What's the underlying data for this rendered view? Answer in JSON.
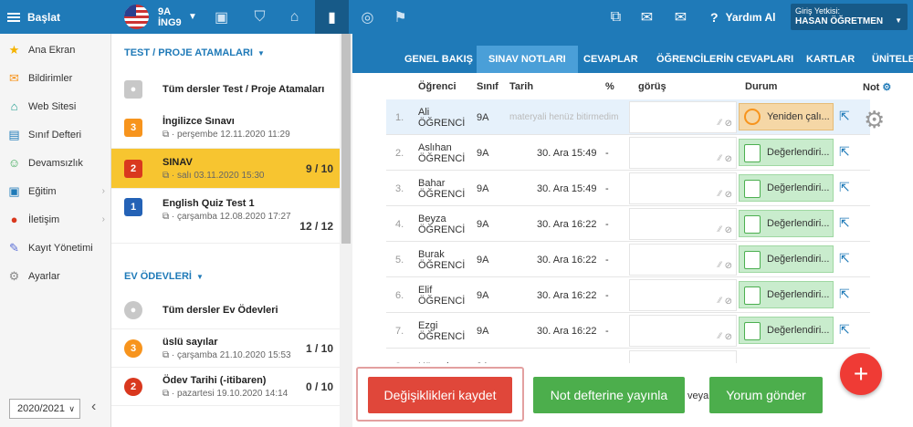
{
  "topbar": {
    "menu_label": "Başlat",
    "class_line1": "9A",
    "class_line2": "İNG9",
    "help_label": "Yardım Al",
    "login_title": "Giriş Yetkisi:",
    "login_user": "HASAN ÖĞRETMEN"
  },
  "sidebar": {
    "items": [
      {
        "label": "Ana Ekran",
        "icon": "star-icon"
      },
      {
        "label": "Bildirimler",
        "icon": "envelope-icon"
      },
      {
        "label": "Web Sitesi",
        "icon": "home-icon"
      },
      {
        "label": "Sınıf Defteri",
        "icon": "notebook-icon"
      },
      {
        "label": "Devamsızlık",
        "icon": "user-icon"
      },
      {
        "label": "Eğitim",
        "icon": "briefcase-icon"
      },
      {
        "label": "İletişim",
        "icon": "chat-icon"
      },
      {
        "label": "Kayıt Yönetimi",
        "icon": "pen-icon"
      },
      {
        "label": "Ayarlar",
        "icon": "gear-icon"
      }
    ],
    "year": "2020/2021"
  },
  "assignments": {
    "title": "TEST / PROJE ATAMALARI",
    "all_label": "Tüm dersler Test / Proje Atamaları",
    "items": [
      {
        "badge": "3",
        "title": "İngilizce Sınavı",
        "date": "perşembe 12.11.2020 11:29",
        "count": ""
      },
      {
        "badge": "2",
        "title": "SINAV",
        "date": "salı 03.11.2020 15:30",
        "count": "9 / 10"
      },
      {
        "badge": "1",
        "title": "English Quiz Test 1",
        "date": "çarşamba 12.08.2020 17:27",
        "count": "12 / 12"
      }
    ]
  },
  "homework": {
    "title": "EV ÖDEVLERİ",
    "all_label": "Tüm dersler Ev Ödevleri",
    "items": [
      {
        "badge": "3",
        "title": "üslü sayılar",
        "date": "çarşamba 21.10.2020 15:53",
        "count": "1 / 10"
      },
      {
        "badge": "2",
        "title": "Ödev Tarihi (-itibaren)",
        "date": "pazartesi 19.10.2020 14:14",
        "count": "0 / 10"
      }
    ]
  },
  "tabs": [
    "GENEL BAKIŞ",
    "SINAV NOTLARI",
    "CEVAPLAR",
    "ÖĞRENCİLERİN CEVAPLARI",
    "KARTLAR",
    "ÜNİTELER"
  ],
  "table": {
    "headers": {
      "student": "Öğrenci",
      "class": "Sınıf",
      "date": "Tarih",
      "percent": "%",
      "opinion": "görüş",
      "status": "Durum",
      "grade": "Not"
    },
    "rows": [
      {
        "n": "1.",
        "first": "Ali",
        "last": "ÖĞRENCİ",
        "cls": "9A",
        "date": "materyali henüz bitirmedim",
        "pct": "",
        "status": "Yeniden çalı..."
      },
      {
        "n": "2.",
        "first": "Aslıhan",
        "last": "ÖĞRENCİ",
        "cls": "9A",
        "date": "30. Ara 15:49",
        "pct": "-",
        "status": "Değerlendiri..."
      },
      {
        "n": "3.",
        "first": "Bahar",
        "last": "ÖĞRENCİ",
        "cls": "9A",
        "date": "30. Ara 15:49",
        "pct": "-",
        "status": "Değerlendiri..."
      },
      {
        "n": "4.",
        "first": "Beyza",
        "last": "ÖĞRENCİ",
        "cls": "9A",
        "date": "30. Ara 16:22",
        "pct": "-",
        "status": "Değerlendiri..."
      },
      {
        "n": "5.",
        "first": "Burak",
        "last": "ÖĞRENCİ",
        "cls": "9A",
        "date": "30. Ara 16:22",
        "pct": "-",
        "status": "Değerlendiri..."
      },
      {
        "n": "6.",
        "first": "Elif",
        "last": "ÖĞRENCİ",
        "cls": "9A",
        "date": "30. Ara 16:22",
        "pct": "-",
        "status": "Değerlendiri..."
      },
      {
        "n": "7.",
        "first": "Ezgi",
        "last": "ÖĞRENCİ",
        "cls": "9A",
        "date": "30. Ara 16:22",
        "pct": "-",
        "status": "Değerlendiri..."
      },
      {
        "n": "8.",
        "first": "Hüseyin",
        "last": "",
        "cls": "9A",
        "date": "",
        "pct": "",
        "status": ""
      }
    ]
  },
  "buttons": {
    "save": "Değişiklikleri kaydet",
    "publish": "Not defterine yayınla",
    "or": "veya",
    "comment": "Yorum gönder",
    "fab": "+"
  }
}
